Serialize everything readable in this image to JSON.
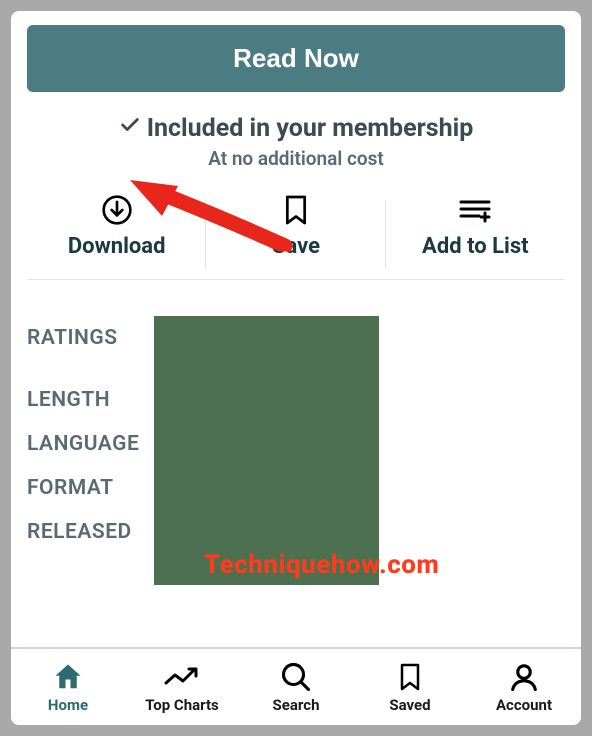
{
  "header": {
    "read_now": "Read Now",
    "membership_title": "Included in your membership",
    "membership_sub": "At no additional cost"
  },
  "actions": {
    "download": "Download",
    "save": "Save",
    "add_to_list": "Add to List"
  },
  "details": {
    "ratings": "RATINGS",
    "length": "LENGTH",
    "language": "LANGUAGE",
    "format": "FORMAT",
    "released": "RELEASED"
  },
  "watermark": "Techniquehow.com",
  "nav": {
    "home": "Home",
    "top_charts": "Top Charts",
    "search": "Search",
    "saved": "Saved",
    "account": "Account"
  }
}
